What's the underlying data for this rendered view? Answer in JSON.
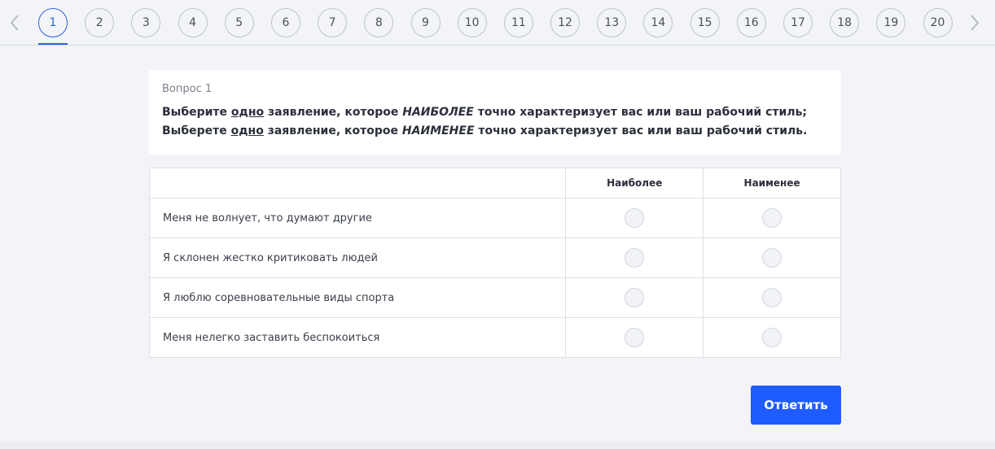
{
  "nav": {
    "questions": [
      "1",
      "2",
      "3",
      "4",
      "5",
      "6",
      "7",
      "8",
      "9",
      "10",
      "11",
      "12",
      "13",
      "14",
      "15",
      "16",
      "17",
      "18",
      "19",
      "20"
    ],
    "active_index": 0
  },
  "question": {
    "label": "Вопрос 1",
    "line1": {
      "pre": "Выберите ",
      "u": "одно",
      "mid": " заявление, которое ",
      "em": "НАИБОЛЕЕ",
      "post": " точно характеризует вас или ваш рабочий стиль;"
    },
    "line2": {
      "pre": "Выберете ",
      "u": "одно",
      "mid": " заявление, которое ",
      "em": "НАИМЕНЕЕ",
      "post": " точно характеризует вас или ваш рабочий стиль."
    }
  },
  "table": {
    "headers": [
      "Наиболее",
      "Наименее"
    ],
    "rows": [
      "Меня не волнует, что думают другие",
      "Я склонен жестко критиковать людей",
      "Я люблю соревновательные виды спорта",
      "Меня нелегко заставить беспокоиться"
    ]
  },
  "submit_label": "Ответить",
  "colors": {
    "accent": "#2f5fe0",
    "button": "#1f5cff"
  },
  "icons": {
    "prev": "chevron-left-icon",
    "next": "chevron-right-icon"
  }
}
